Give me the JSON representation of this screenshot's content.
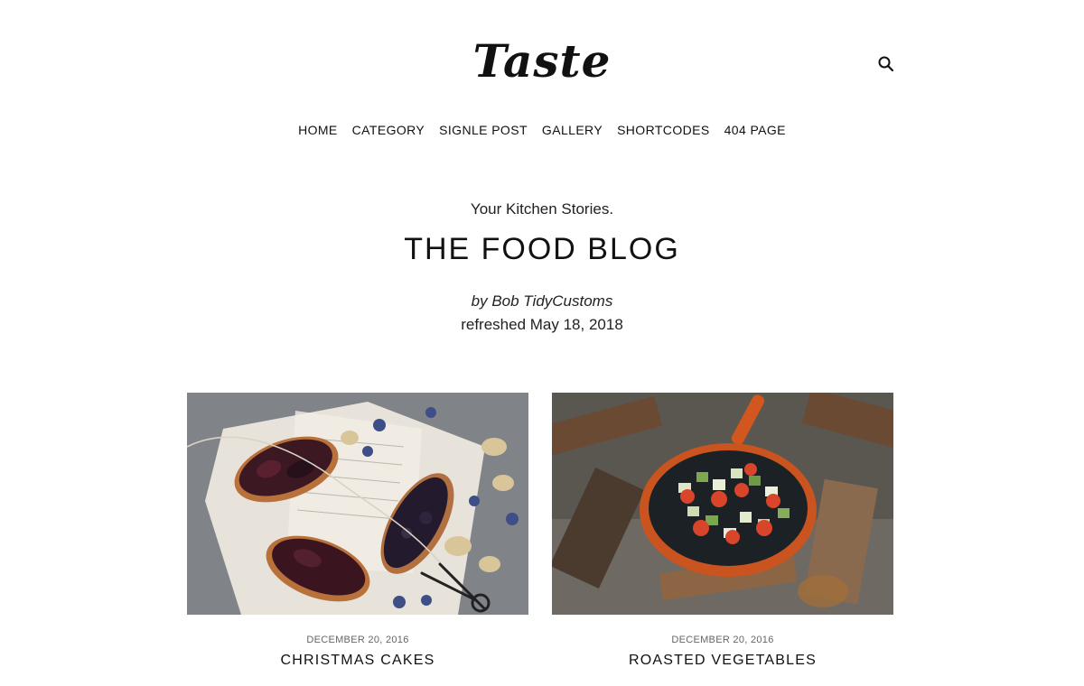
{
  "header": {
    "logo_text": "Taste",
    "search_icon": "search-icon"
  },
  "nav": {
    "items": [
      {
        "label": "HOME"
      },
      {
        "label": "CATEGORY"
      },
      {
        "label": "SIGNLE POST"
      },
      {
        "label": "GALLERY"
      },
      {
        "label": "SHORTCODES"
      },
      {
        "label": "404 PAGE"
      }
    ]
  },
  "hero": {
    "tagline": "Your Kitchen Stories.",
    "title": "THE FOOD BLOG",
    "byline": "by Bob TidyCustoms",
    "refreshed": "refreshed May 18, 2018"
  },
  "posts": [
    {
      "date": "DECEMBER 20, 2016",
      "title": "CHRISTMAS CAKES",
      "image": "eclairs-with-berries-photo"
    },
    {
      "date": "DECEMBER 20, 2016",
      "title": "ROASTED VEGETABLES",
      "image": "vegetables-in-pan-over-fire-photo"
    }
  ]
}
